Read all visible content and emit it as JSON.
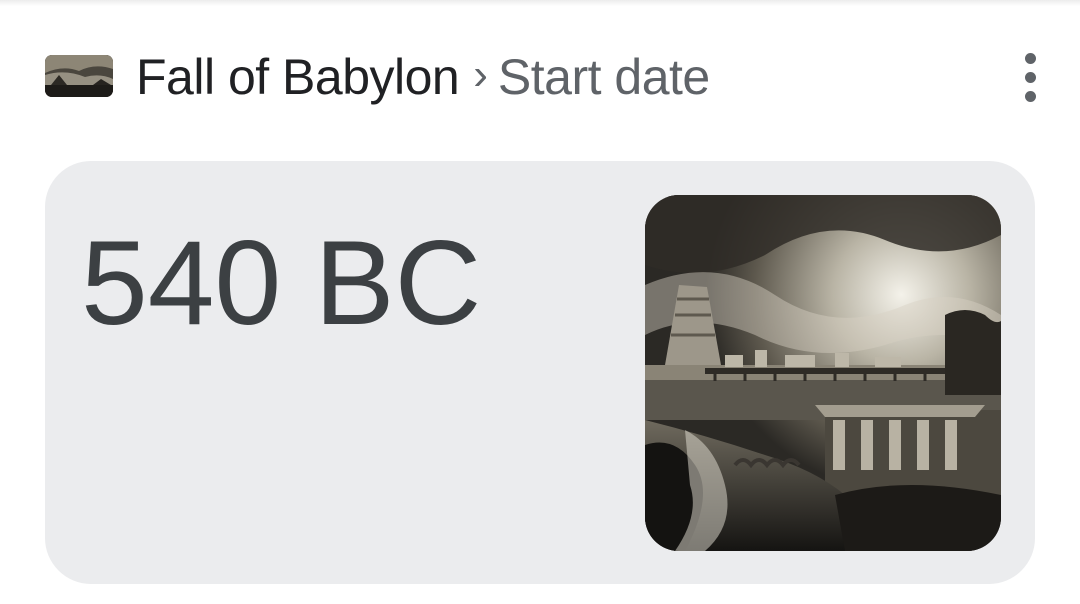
{
  "header": {
    "entity": "Fall of Babylon",
    "separator": "›",
    "attribute": "Start date",
    "thumbnail_icon": "babylon-painting-thumbnail",
    "menu_icon": "more-vert-icon"
  },
  "answer": {
    "value": "540 BC",
    "image_icon": "fall-of-babylon-engraving"
  },
  "colors": {
    "card_background": "#ebecee",
    "primary_text": "#202124",
    "secondary_text": "#5f6368",
    "answer_text": "#3c4043"
  }
}
